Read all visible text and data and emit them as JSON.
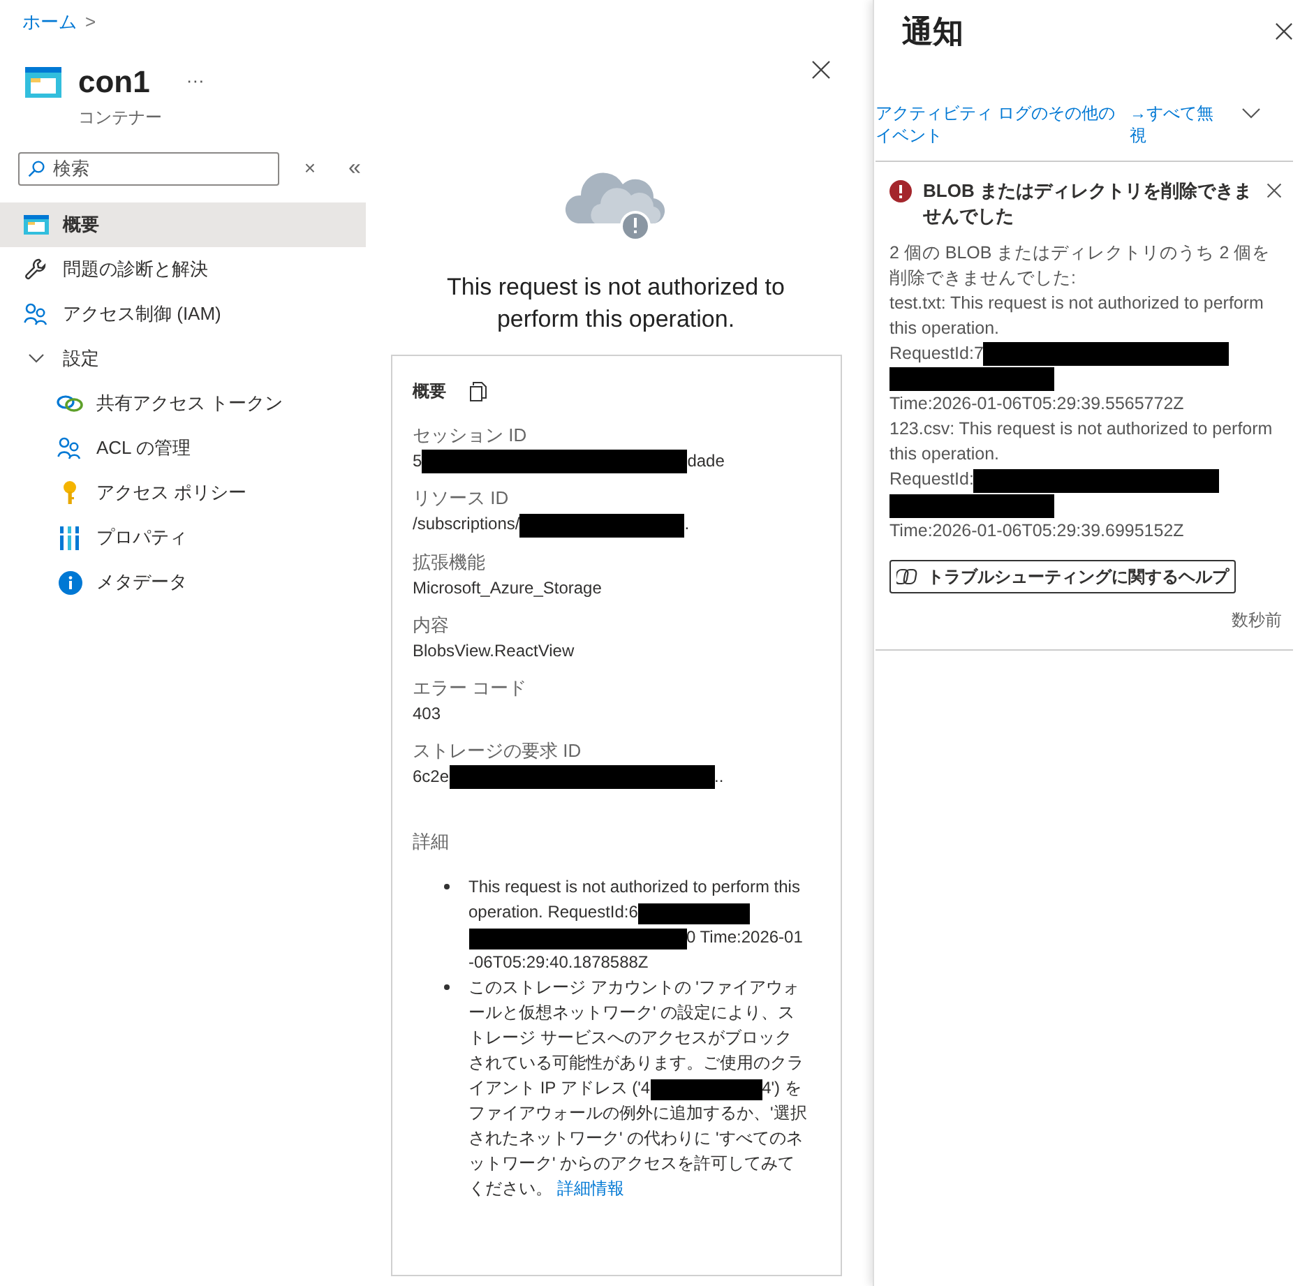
{
  "breadcrumb": {
    "link": "ホーム",
    "separator": ">"
  },
  "resource": {
    "title": "con1",
    "more": "···",
    "subtitle": "コンテナー"
  },
  "search": {
    "placeholder": "検索",
    "clear": "×",
    "collapse": "«"
  },
  "nav": [
    {
      "kind": "overview",
      "label": "概要",
      "selected": true
    },
    {
      "kind": "wrench",
      "label": "問題の診断と解決",
      "selected": false
    },
    {
      "kind": "people",
      "label": "アクセス制御 (IAM)",
      "selected": false
    },
    {
      "kind": "group",
      "label": "設定",
      "expanded": true,
      "children": [
        {
          "kind": "link",
          "label": "共有アクセス トークン",
          "selected": false
        },
        {
          "kind": "people",
          "label": "ACL の管理",
          "selected": false
        },
        {
          "kind": "key",
          "label": "アクセス ポリシー",
          "selected": false
        },
        {
          "kind": "bars",
          "label": "プロパティ",
          "selected": false
        },
        {
          "kind": "info",
          "label": "メタデータ",
          "selected": false
        }
      ]
    }
  ],
  "error": {
    "message": "This request is not authorized to perform this operation.",
    "card": {
      "title": "概要",
      "fields": [
        {
          "label": "セッション ID",
          "segments": [
            {
              "kind": "text",
              "text": "5"
            },
            {
              "kind": "redacted"
            },
            {
              "kind": "text",
              "text": "dade"
            }
          ]
        },
        {
          "label": "リソース ID",
          "segments": [
            {
              "kind": "text",
              "text": "/subscriptions/"
            },
            {
              "kind": "redacted"
            },
            {
              "kind": "text",
              "text": "."
            }
          ]
        },
        {
          "label": "拡張機能",
          "segments": [
            {
              "kind": "text",
              "text": "Microsoft_Azure_Storage"
            }
          ]
        },
        {
          "label": "内容",
          "segments": [
            {
              "kind": "text",
              "text": "BlobsView.ReactView"
            }
          ]
        },
        {
          "label": "エラー コード",
          "segments": [
            {
              "kind": "text",
              "text": "403"
            }
          ]
        },
        {
          "label": "ストレージの要求 ID",
          "segments": [
            {
              "kind": "text",
              "text": "6c2e"
            },
            {
              "kind": "redacted"
            },
            {
              "kind": "text",
              "text": ".."
            }
          ]
        }
      ],
      "details_title": "詳細",
      "details": [
        {
          "segments": [
            {
              "kind": "text",
              "text": "This request is not authorized to perform this operation. RequestId:6"
            },
            {
              "kind": "redacted"
            },
            {
              "kind": "redacted"
            },
            {
              "kind": "text",
              "text": "0 Time:2026-01-06T05:29:40.1878588Z"
            }
          ]
        },
        {
          "segments": [
            {
              "kind": "text",
              "text": "このストレージ アカウントの 'ファイアウォールと仮想ネットワーク' の設定により、ストレージ サービスへのアクセスがブロックされている可能性があります。ご使用のクライアント IP アドレス ('4"
            },
            {
              "kind": "redacted"
            },
            {
              "kind": "text",
              "text": "4') をファイアウォールの例外に追加するか、'選択されたネットワーク' の代わりに 'すべてのネットワーク' からのアクセスを許可してみてください。 "
            },
            {
              "kind": "link",
              "text": "詳細情報"
            }
          ]
        }
      ]
    }
  },
  "notifications": {
    "title": "通知",
    "activity_link": "アクティビティ ログのその他のイベント",
    "dismiss_all": "→すべて無視",
    "items": [
      {
        "title": "BLOB またはディレクトリを削除できませんでした",
        "lines": [
          {
            "segments": [
              {
                "kind": "text",
                "text": "2 個の BLOB またはディレクトリのうち 2 個を削除できませんでした:"
              }
            ]
          },
          {
            "segments": [
              {
                "kind": "text",
                "text": "test.txt: This request is not authorized to perform this operation."
              }
            ]
          },
          {
            "segments": [
              {
                "kind": "text",
                "text": "RequestId:7"
              },
              {
                "kind": "redacted"
              },
              {
                "kind": "redacted"
              }
            ]
          },
          {
            "segments": [
              {
                "kind": "text",
                "text": "Time:2026-01-06T05:29:39.5565772Z"
              }
            ]
          },
          {
            "segments": [
              {
                "kind": "text",
                "text": "123.csv: This request is not authorized to perform this operation."
              }
            ]
          },
          {
            "segments": [
              {
                "kind": "text",
                "text": "RequestId:"
              },
              {
                "kind": "redacted"
              },
              {
                "kind": "redacted"
              }
            ]
          },
          {
            "segments": [
              {
                "kind": "text",
                "text": "Time:2026-01-06T05:29:39.6995152Z"
              }
            ]
          }
        ],
        "help_button": "トラブルシューティングに関するヘルプ",
        "time": "数秒前"
      }
    ]
  }
}
